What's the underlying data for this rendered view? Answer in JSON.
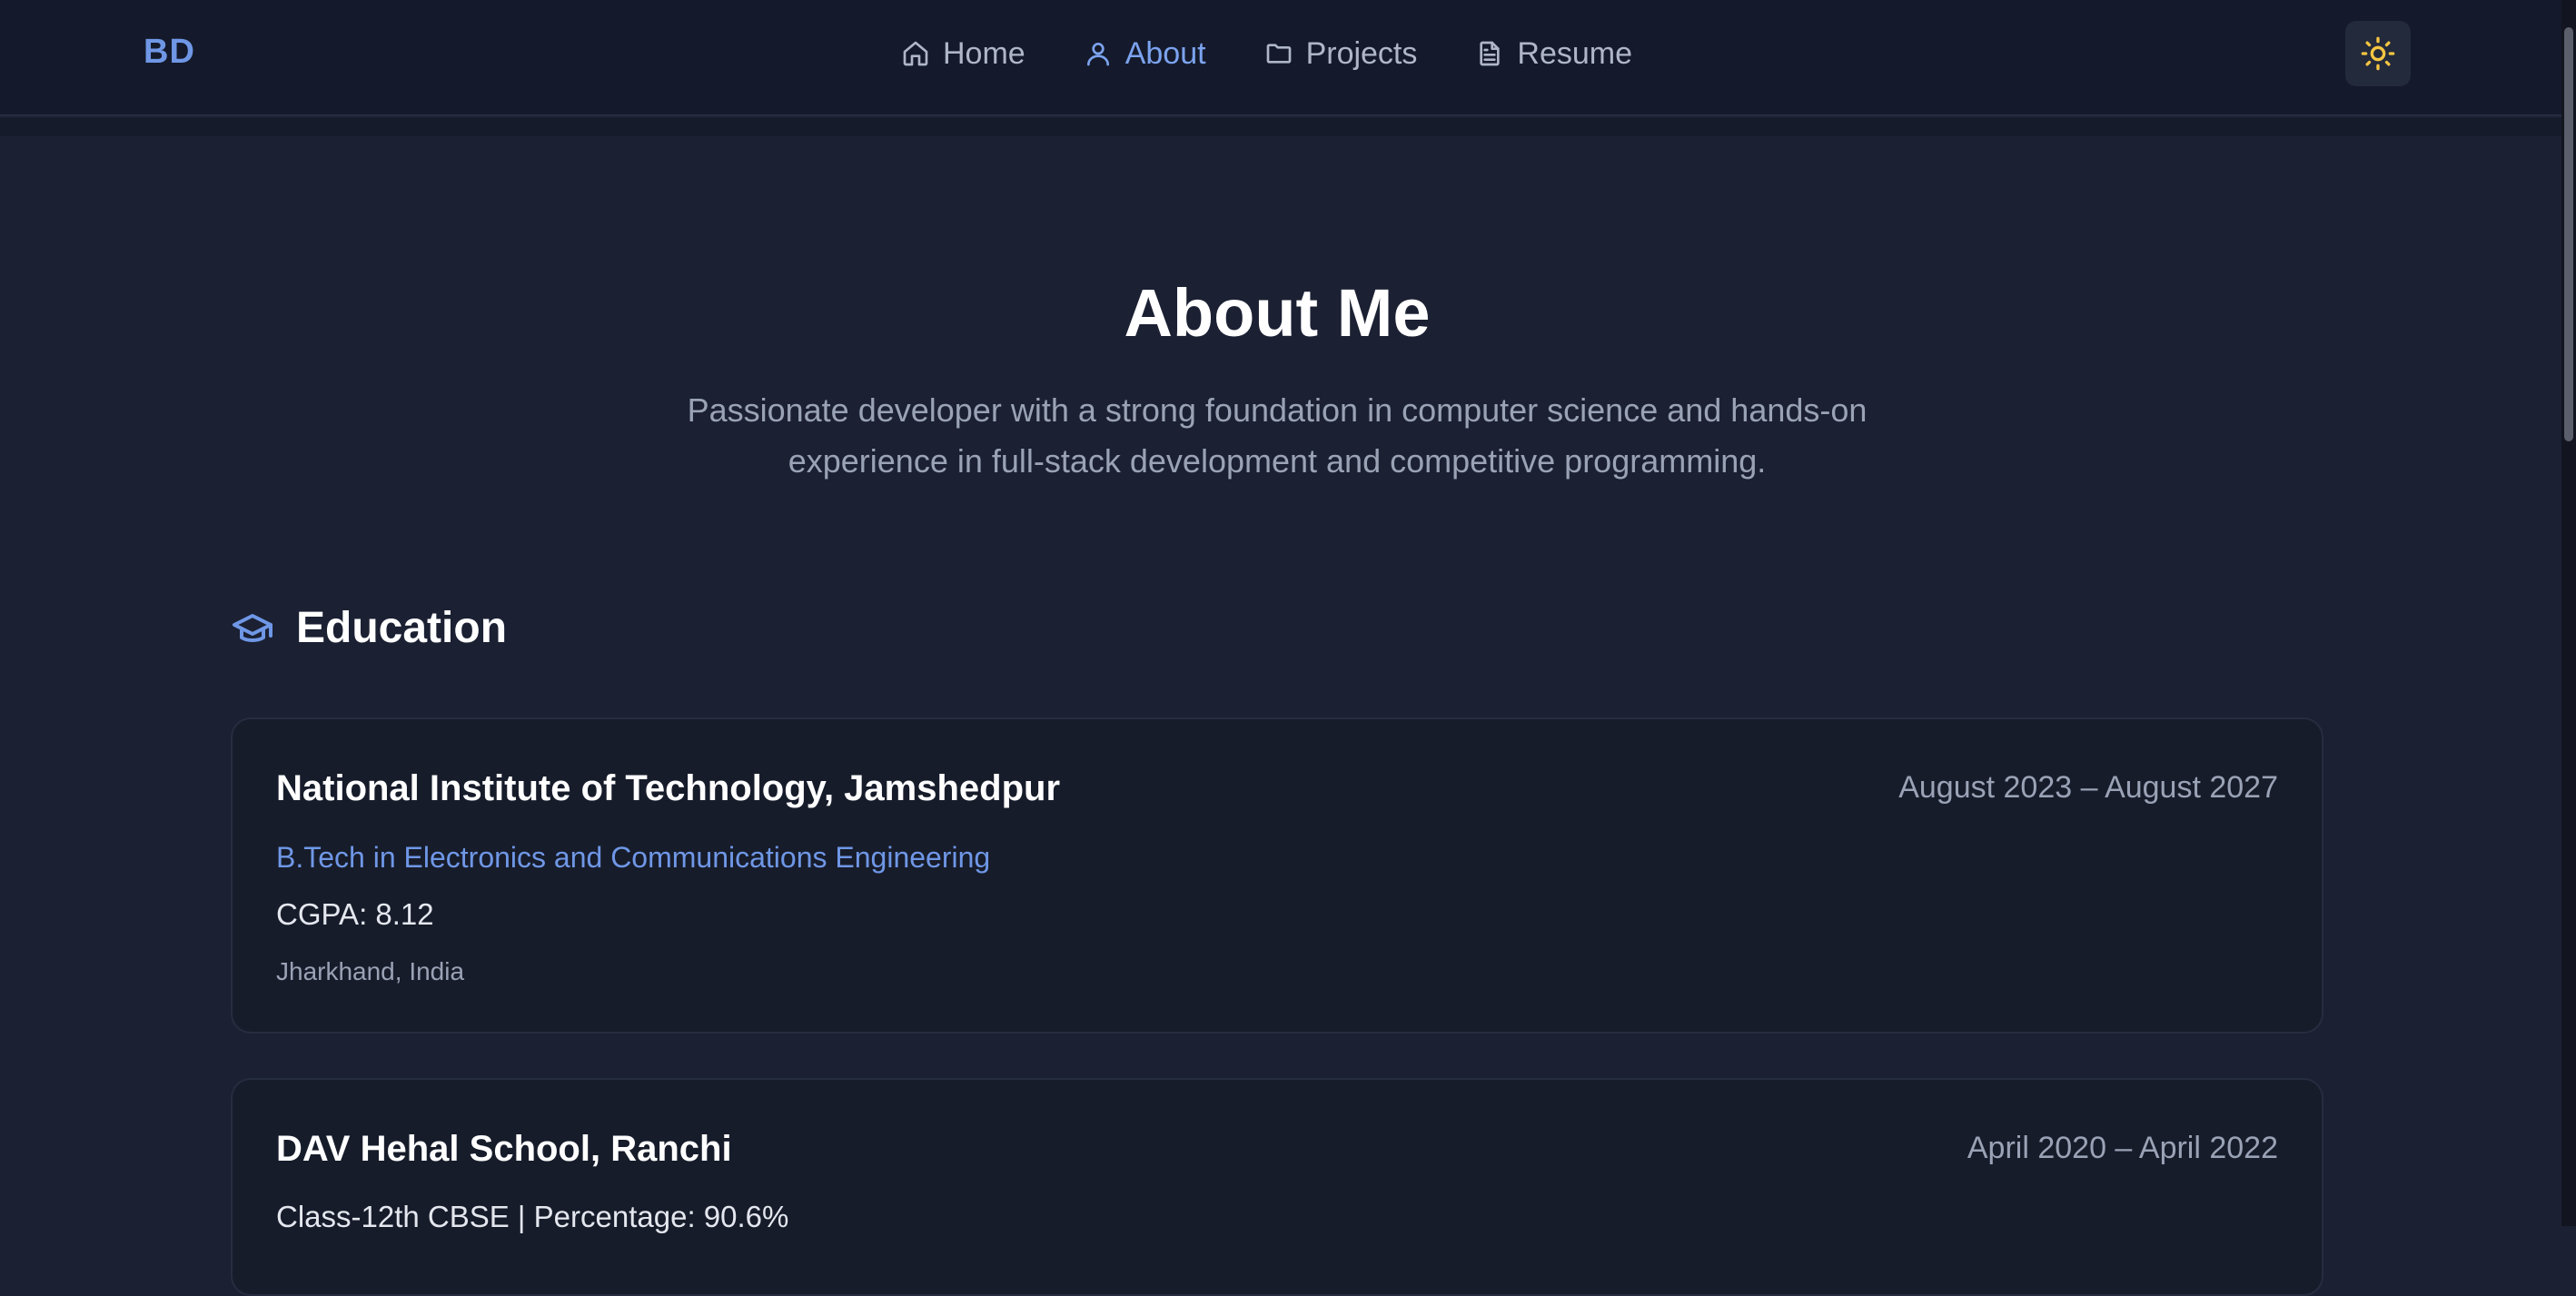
{
  "nav": {
    "logo": "BD",
    "links": [
      {
        "label": "Home",
        "icon": "home-icon"
      },
      {
        "label": "About",
        "icon": "user-icon",
        "active": true
      },
      {
        "label": "Projects",
        "icon": "folder-icon"
      },
      {
        "label": "Resume",
        "icon": "file-text-icon"
      }
    ],
    "theme_icon": "sun-icon"
  },
  "hero": {
    "title": "About Me",
    "subtitle": "Passionate developer with a strong foundation in computer science and hands-on experience in full-stack development and competitive programming."
  },
  "education": {
    "heading": "Education",
    "icon": "graduation-cap-icon",
    "items": [
      {
        "institution": "National Institute of Technology, Jamshedpur",
        "dates": "August 2023 – August 2027",
        "degree": "B.Tech in Electronics and Communications Engineering",
        "score": "CGPA: 8.12",
        "location": "Jharkhand, India"
      },
      {
        "institution": "DAV Hehal School, Ranchi",
        "dates": "April 2020 – April 2022",
        "score": "Class-12th CBSE | Percentage: 90.6%"
      }
    ]
  },
  "colors": {
    "background": "#1b2033",
    "navbar": "#141a2b",
    "card": "#171c2b",
    "accent": "#6f97e6",
    "sun": "#f5c542"
  }
}
